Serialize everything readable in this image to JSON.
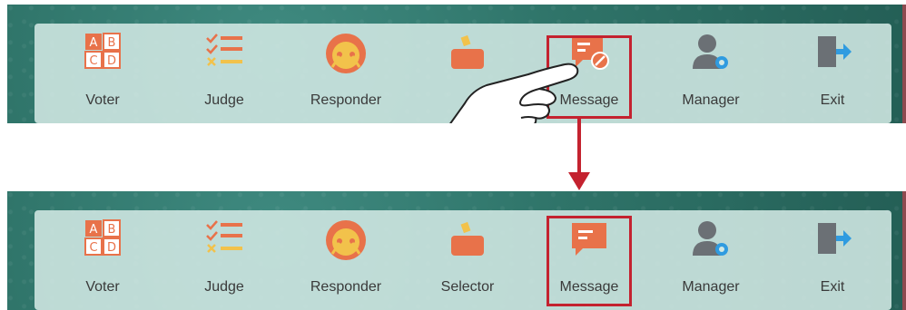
{
  "toolbars": [
    {
      "items": [
        {
          "label": "Voter",
          "icon": "abcd-icon"
        },
        {
          "label": "Judge",
          "icon": "checklist-icon"
        },
        {
          "label": "Responder",
          "icon": "responder-face-icon"
        },
        {
          "label": "",
          "icon": "selector-box-icon"
        },
        {
          "label": "Message",
          "icon": "message-disabled-icon"
        },
        {
          "label": "Manager",
          "icon": "manager-gear-icon"
        },
        {
          "label": "Exit",
          "icon": "exit-icon"
        }
      ],
      "highlighted": "Message"
    },
    {
      "items": [
        {
          "label": "Voter",
          "icon": "abcd-icon"
        },
        {
          "label": "Judge",
          "icon": "checklist-icon"
        },
        {
          "label": "Responder",
          "icon": "responder-face-icon"
        },
        {
          "label": "Selector",
          "icon": "selector-box-icon"
        },
        {
          "label": "Message",
          "icon": "message-icon"
        },
        {
          "label": "Manager",
          "icon": "manager-gear-icon"
        },
        {
          "label": "Exit",
          "icon": "exit-icon"
        }
      ],
      "highlighted": "Message"
    }
  ],
  "colors": {
    "board": "#2f7469",
    "toolbar": "#d2e8e4",
    "highlight": "#c4222f",
    "accent_orange": "#e8724a",
    "accent_yellow": "#f2c24b",
    "accent_blue": "#2f9be0",
    "gray": "#6b7075"
  }
}
